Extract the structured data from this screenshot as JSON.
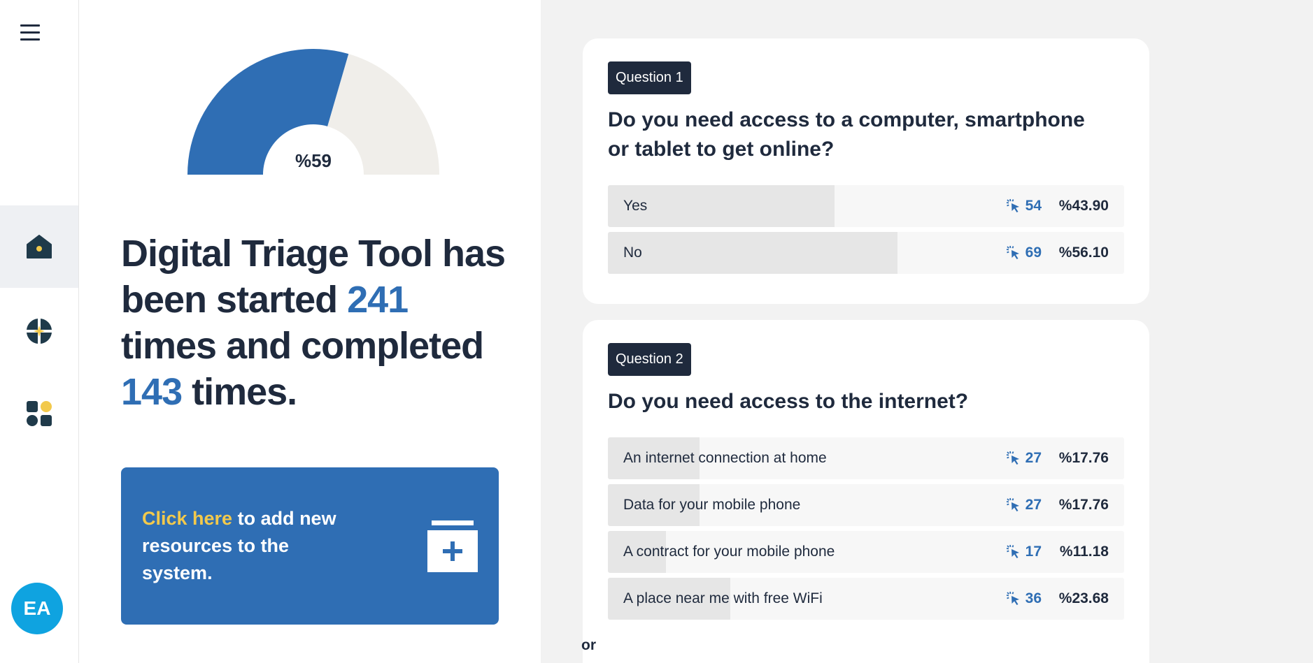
{
  "sidebar": {
    "avatar_initials": "EA",
    "colors": {
      "dark": "#1f3a4a",
      "accent": "#f2c94c"
    }
  },
  "gauge": {
    "value_label": "%59",
    "fraction": 0.59,
    "fill_color": "#2f6eb4",
    "track_color": "#f0eeea"
  },
  "headline": {
    "part1": "Digital Triage Tool has been started ",
    "started": "241",
    "part2": " times and completed ",
    "completed": "143",
    "part3": " times."
  },
  "cta": {
    "link": "Click here",
    "text": " to add new resources to the system."
  },
  "questions": [
    {
      "badge": "Question 1",
      "title": "Do you need access to a computer, smartphone or tablet to get online?",
      "options": [
        {
          "label": "Yes",
          "count": "54",
          "pct": "%43.90",
          "fraction": 0.439
        },
        {
          "label": "No",
          "count": "69",
          "pct": "%56.10",
          "fraction": 0.561
        }
      ]
    },
    {
      "badge": "Question 2",
      "title": "Do you need access to the internet?",
      "options": [
        {
          "label": "An internet connection at home",
          "count": "27",
          "pct": "%17.76",
          "fraction": 0.1776
        },
        {
          "label": "Data for your mobile phone",
          "count": "27",
          "pct": "%17.76",
          "fraction": 0.1776
        },
        {
          "label": "A contract for your mobile phone",
          "count": "17",
          "pct": "%11.18",
          "fraction": 0.1118
        },
        {
          "label": "A place near me with free WiFi",
          "count": "36",
          "pct": "%23.68",
          "fraction": 0.2368
        }
      ],
      "footer": "or"
    }
  ]
}
